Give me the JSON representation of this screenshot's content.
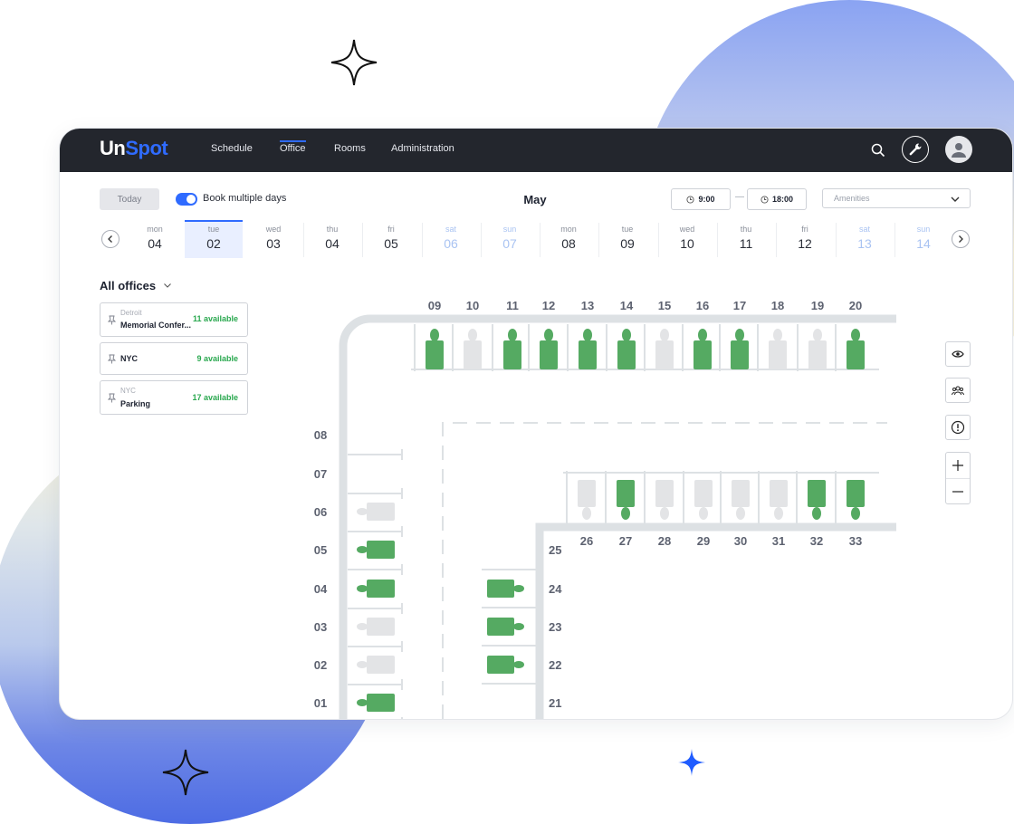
{
  "nav": {
    "brand_a": "Un",
    "brand_b": "Spot",
    "items": [
      "Schedule",
      "Office",
      "Rooms",
      "Administration"
    ],
    "active": "Office",
    "icons": [
      "search-icon",
      "wrench-icon",
      "avatar-icon"
    ]
  },
  "toolbar": {
    "today_label": "Today",
    "book_multiple_label": "Book multiple days",
    "book_multiple_on": true,
    "month": "May",
    "time_from": "9:00",
    "time_separator": "—",
    "time_to": "18:00",
    "amenities_placeholder": "Amenities"
  },
  "days": [
    {
      "name": "mon",
      "date": "04",
      "weekend": false
    },
    {
      "name": "tue",
      "date": "02",
      "weekend": false,
      "selected": true
    },
    {
      "name": "wed",
      "date": "03",
      "weekend": false
    },
    {
      "name": "thu",
      "date": "04",
      "weekend": false
    },
    {
      "name": "fri",
      "date": "05",
      "weekend": false
    },
    {
      "name": "sat",
      "date": "06",
      "weekend": true
    },
    {
      "name": "sun",
      "date": "07",
      "weekend": true
    },
    {
      "name": "mon",
      "date": "08",
      "weekend": false
    },
    {
      "name": "tue",
      "date": "09",
      "weekend": false
    },
    {
      "name": "wed",
      "date": "10",
      "weekend": false
    },
    {
      "name": "thu",
      "date": "11",
      "weekend": false
    },
    {
      "name": "fri",
      "date": "12",
      "weekend": false
    },
    {
      "name": "sat",
      "date": "13",
      "weekend": true
    },
    {
      "name": "sun",
      "date": "14",
      "weekend": true
    }
  ],
  "offices": {
    "title": "All offices",
    "items": [
      {
        "city": "Detroit",
        "name": "Memorial Confer...",
        "available": "11 available"
      },
      {
        "city": "",
        "name": "NYC",
        "available": "9 available"
      },
      {
        "city": "NYC",
        "name": "Parking",
        "available": "17 available"
      }
    ]
  },
  "floor": {
    "top_row": [
      {
        "label": "09",
        "available": true
      },
      {
        "label": "10",
        "available": false
      },
      {
        "label": "11",
        "available": true
      },
      {
        "label": "12",
        "available": true
      },
      {
        "label": "13",
        "available": true
      },
      {
        "label": "14",
        "available": true
      },
      {
        "label": "15",
        "available": false
      },
      {
        "label": "16",
        "available": true
      },
      {
        "label": "17",
        "available": true
      },
      {
        "label": "18",
        "available": false
      },
      {
        "label": "19",
        "available": false
      },
      {
        "label": "20",
        "available": true
      }
    ],
    "left_column": [
      {
        "label": "08",
        "desk": false,
        "available": false
      },
      {
        "label": "07",
        "desk": false,
        "available": false
      },
      {
        "label": "06",
        "desk": true,
        "available": false
      },
      {
        "label": "05",
        "desk": true,
        "available": true
      },
      {
        "label": "04",
        "desk": true,
        "available": true
      },
      {
        "label": "03",
        "desk": true,
        "available": false
      },
      {
        "label": "02",
        "desk": true,
        "available": false
      },
      {
        "label": "01",
        "desk": true,
        "available": true
      }
    ],
    "middle_column": [
      {
        "label": "25",
        "desk": false,
        "available": false
      },
      {
        "label": "24",
        "desk": true,
        "available": true
      },
      {
        "label": "23",
        "desk": true,
        "available": true
      },
      {
        "label": "22",
        "desk": true,
        "available": true
      },
      {
        "label": "21",
        "desk": false,
        "available": false
      }
    ],
    "bottom_row": [
      {
        "label": "26",
        "available": false
      },
      {
        "label": "27",
        "available": true
      },
      {
        "label": "28",
        "available": false
      },
      {
        "label": "29",
        "available": false
      },
      {
        "label": "30",
        "available": false
      },
      {
        "label": "31",
        "available": false
      },
      {
        "label": "32",
        "available": true
      },
      {
        "label": "33",
        "available": true
      }
    ],
    "colors": {
      "available": "#55aa62",
      "unavailable": "#e3e4e6",
      "wall": "#dde1e4"
    }
  },
  "floor_tools": [
    "eye-icon",
    "people-icon",
    "alert-icon",
    "zoom-in-icon",
    "zoom-out-icon"
  ]
}
